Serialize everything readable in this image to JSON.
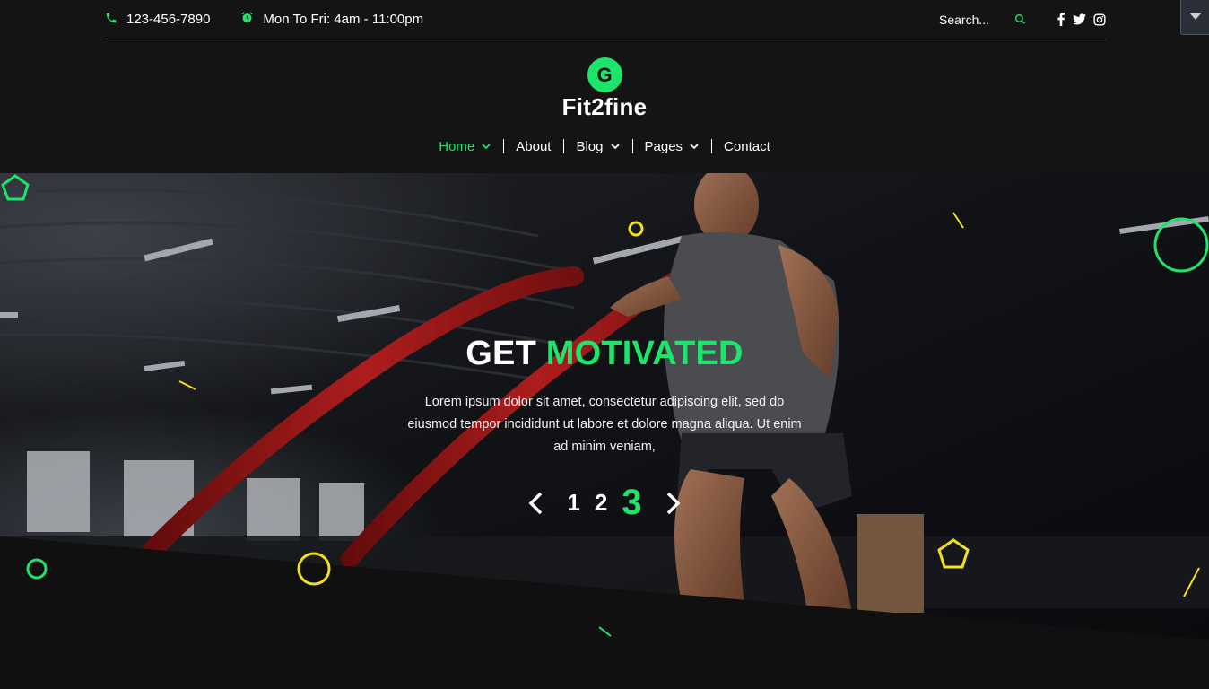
{
  "topbar": {
    "phone": "123-456-7890",
    "hours": "Mon To Fri: 4am - 11:00pm",
    "search_placeholder": "Search..."
  },
  "brand": {
    "logo_letter": "G",
    "name": "Fit2fine"
  },
  "nav": {
    "items": [
      {
        "label": "Home",
        "dropdown": true,
        "active": true
      },
      {
        "label": "About",
        "dropdown": false
      },
      {
        "label": "Blog",
        "dropdown": true
      },
      {
        "label": "Pages",
        "dropdown": true
      },
      {
        "label": "Contact",
        "dropdown": false
      }
    ]
  },
  "hero": {
    "title_part1": "GET",
    "title_part2": "MOTIVATED",
    "text": "Lorem ipsum dolor sit amet, consectetur adipiscing elit, sed do eiusmod tempor incididunt ut labore et dolore magna aliqua. Ut enim ad minim veniam,",
    "pages": [
      "1",
      "2",
      "3"
    ],
    "active_page": "3"
  },
  "colors": {
    "accent": "#1de46b",
    "background": "#141414",
    "decor_yellow": "#f2e11a"
  }
}
